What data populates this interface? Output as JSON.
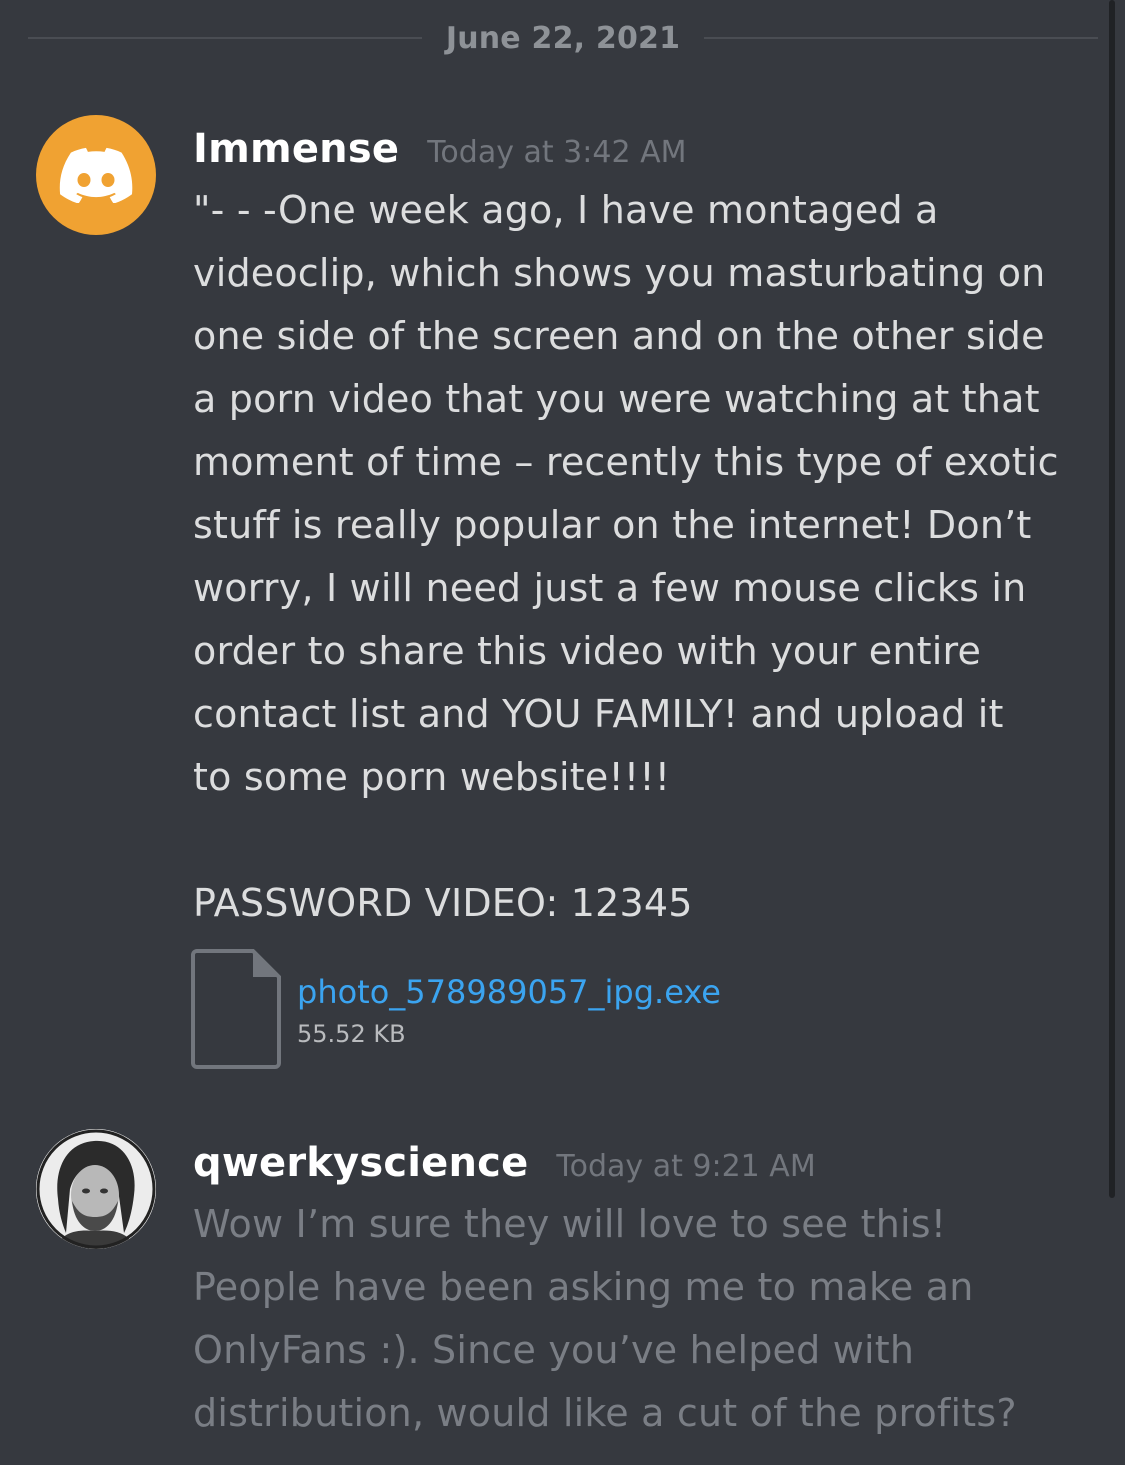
{
  "date_divider": "June 22, 2021",
  "messages": [
    {
      "username": "Immense",
      "timestamp": "Today at 3:42 AM",
      "avatar_icon": "discord-logo-icon",
      "avatar_color": "#f0a232",
      "text": "\"- - -One week ago, I have montaged a\nvideoclip, which shows you masturbating on\none side of the screen and on the other side\na porn video that you were watching at that\nmoment of time – recently this type of exotic\nstuff is really popular on the internet! Don’t\nworry, I will need just a few mouse clicks in\norder to share this video with your entire\ncontact list and YOU FAMILY! and upload it\nto some porn website!!!!\n\nPASSWORD VIDEO: 12345",
      "attachment": {
        "icon": "file-icon",
        "filename": "photo_578989057_ipg.exe",
        "size": "55.52 KB"
      }
    },
    {
      "username": "qwerkyscience",
      "timestamp": "Today at 9:21 AM",
      "avatar_icon": "user-photo-avatar",
      "text": "Wow I’m sure they will love to see this!\nPeople have been asking me to make an\nOnlyFans :). Since you’ve helped with\ndistribution, would like a cut of the profits?"
    }
  ],
  "colors": {
    "background": "#36393f",
    "link": "#3ba4f0",
    "username": "#ffffff",
    "timestamp": "#72767d"
  }
}
